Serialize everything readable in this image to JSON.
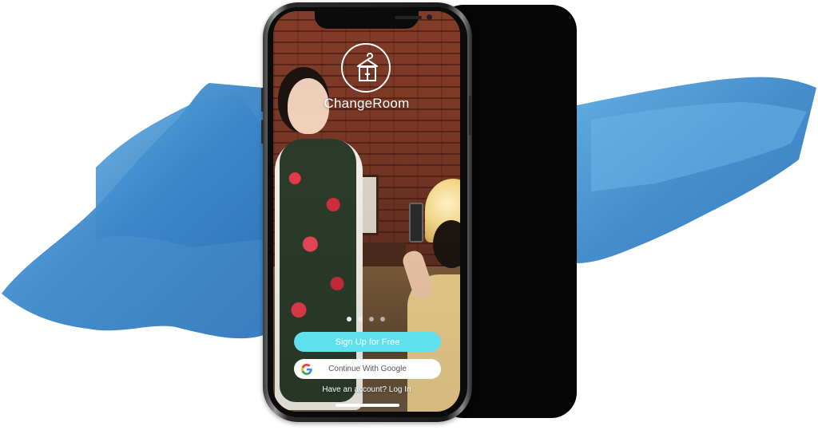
{
  "app": {
    "name": "ChangeRoom",
    "logo_icon": "wardrobe-hanger-icon"
  },
  "onboarding": {
    "page_count": 4,
    "active_page": 1
  },
  "actions": {
    "signup_label": "Sign Up for Free",
    "google_label": "Continue With Google",
    "login_prompt": "Have an account? Log In"
  },
  "colors": {
    "brush_blue": "#3d8fd0",
    "signup_button": "#5fe0ef",
    "google_button": "#ffffff"
  }
}
